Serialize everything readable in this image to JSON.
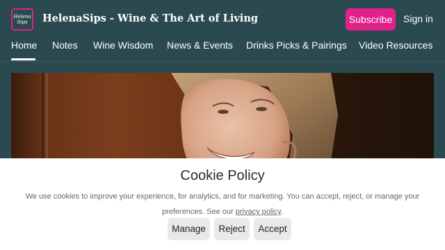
{
  "header": {
    "logo_text": "Helena Sips",
    "site_title": "HelenaSips - Wine & The Art of Living",
    "subscribe_label": "Subscribe",
    "signin_label": "Sign in",
    "accent_color": "#e0218a",
    "background_color": "#2b4a4f"
  },
  "nav": {
    "items": [
      {
        "label": "Home",
        "active": true
      },
      {
        "label": "Notes"
      },
      {
        "label": "Wine Wisdom"
      },
      {
        "label": "News & Events"
      },
      {
        "label": "Drinks Picks & Pairings"
      },
      {
        "label": "Video Resources"
      }
    ]
  },
  "hero": {
    "image": "portrait-photo"
  },
  "cookie": {
    "title": "Cookie Policy",
    "text_before_link": "We use cookies to improve your experience, for analytics, and for marketing. You can accept, reject, or manage your preferences. See our ",
    "link_text": "privacy policy",
    "text_after_link": ".",
    "buttons": {
      "manage": "Manage",
      "reject": "Reject",
      "accept": "Accept"
    }
  }
}
